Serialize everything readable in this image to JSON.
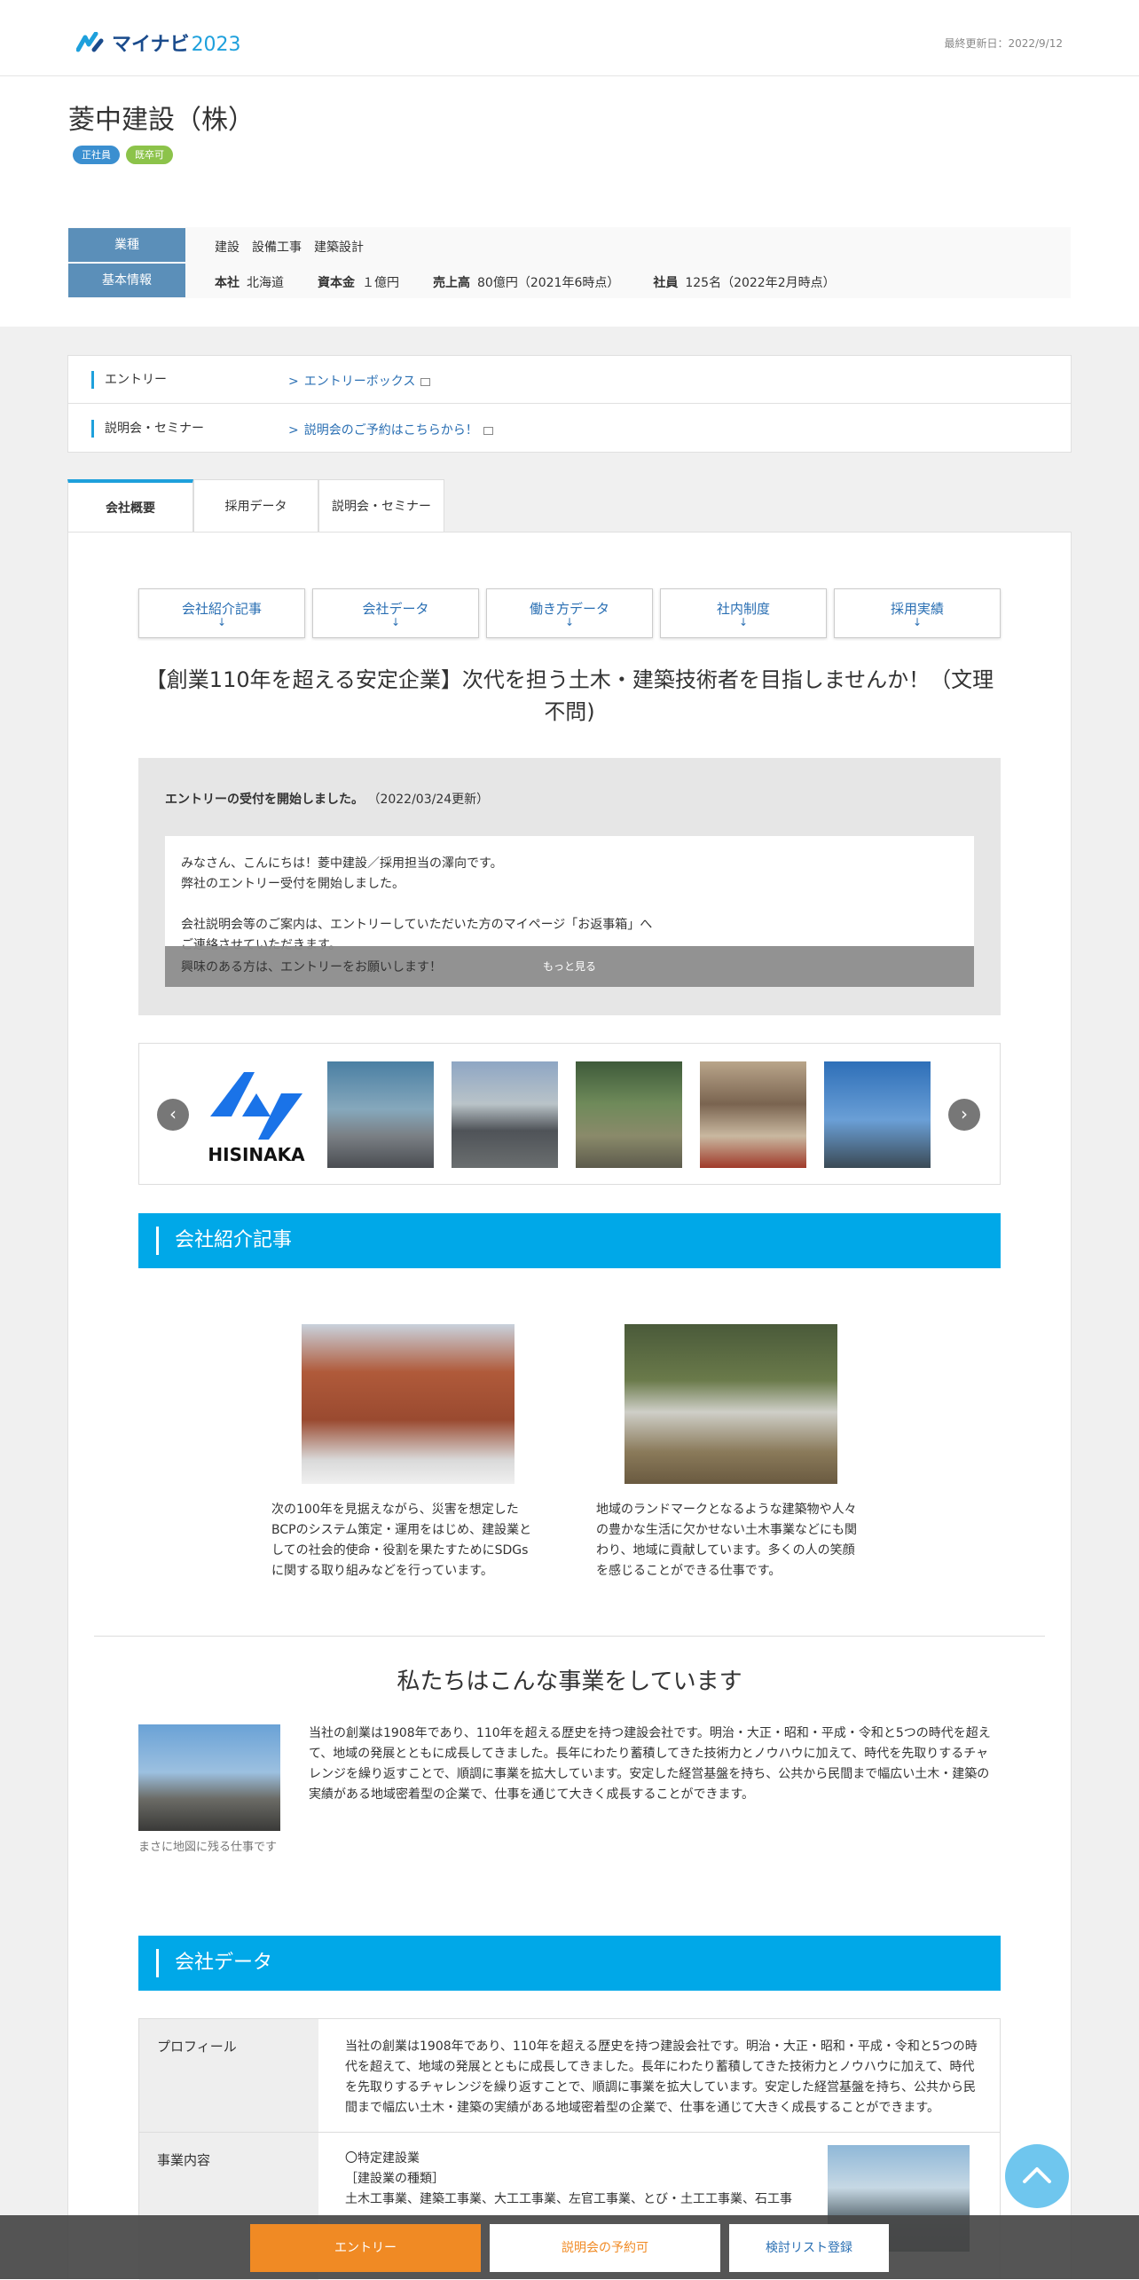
{
  "header": {
    "logo_text": "マイナビ",
    "logo_year": "2023",
    "updated": "最終更新日：2022/9/12"
  },
  "company": {
    "name": "菱中建設（株）",
    "badges": [
      "正社員",
      "既卒可"
    ]
  },
  "info": {
    "industry_label": "業種",
    "industry_value": "建設　設備工事　建築設計",
    "basic_label": "基本情報",
    "hq_label": "本社",
    "hq_value": "北海道",
    "capital_label": "資本金",
    "capital_value": "１億円",
    "sales_label": "売上高",
    "sales_value": "80億円（2021年6時点）",
    "employees_label": "社員",
    "employees_value": "125名（2022年2月時点）"
  },
  "links": [
    {
      "label": "エントリー",
      "link": "エントリーボックス"
    },
    {
      "label": "説明会・セミナー",
      "link": "説明会のご予約はこちらから！"
    }
  ],
  "tabs": [
    "会社概要",
    "採用データ",
    "説明会・セミナー"
  ],
  "anchors": [
    "会社紹介記事",
    "会社データ",
    "働き方データ",
    "社内制度",
    "採用実績"
  ],
  "anchor_arrow": "↓",
  "headline": "【創業110年を超える安定企業】次代を担う土木・建築技術者を目指しませんか！（文理不問)",
  "news": {
    "title": "エントリーの受付を開始しました。",
    "date": "（2022/03/24更新）",
    "lines": [
      "みなさん、こんにちは！菱中建設／採用担当の澤向です。",
      "弊社のエントリー受付を開始しました。",
      "",
      "会社説明会等のご案内は、エントリーしていただいた方のマイページ「お返事箱」へ",
      "ご連絡させていただきます。"
    ],
    "last_line": "興味のある方は、エントリーをお願いします！",
    "more": "もっと見る"
  },
  "carousel": {
    "logo_text": "HISINAKA",
    "prev": "‹",
    "next": "›"
  },
  "sections": {
    "intro": "会社紹介記事",
    "data": "会社データ"
  },
  "articles": [
    {
      "text": "次の100年を見据えながら、災害を想定したBCPのシステム策定・運用をはじめ、建設業としての社会的使命・役割を果たすためにSDGsに関する取り組みなどを行っています。"
    },
    {
      "text": "地域のランドマークとなるような建築物や人々の豊かな生活に欠かせない土木事業などにも関わり、地域に貢献しています。多くの人の笑顔を感じることができる仕事です。"
    }
  ],
  "business": {
    "title": "私たちはこんな事業をしています",
    "caption": "まさに地図に残る仕事です",
    "text": "当社の創業は1908年であり、110年を超える歴史を持つ建設会社です。明治・大正・昭和・平成・令和と5つの時代を超えて、地域の発展とともに成長してきました。長年にわたり蓄積してきた技術力とノウハウに加えて、時代を先取りするチャレンジを繰り返すことで、順調に事業を拡大しています。安定した経営基盤を持ち、公共から民間まで幅広い土木・建築の実績がある地域密着型の企業で、仕事を通じて大きく成長することができます。"
  },
  "company_data": {
    "profile_label": "プロフィール",
    "profile_text": "当社の創業は1908年であり、110年を超える歴史を持つ建設会社です。明治・大正・昭和・平成・令和と5つの時代を超えて、地域の発展とともに成長してきました。長年にわたり蓄積してきた技術力とノウハウに加えて、時代を先取りするチャレンジを繰り返すことで、順調に事業を拡大しています。安定した経営基盤を持ち、公共から民間まで幅広い土木・建築の実績がある地域密着型の企業で、仕事を通じて大きく成長することができます。",
    "business_label": "事業内容",
    "business_lines": [
      "〇特定建設業",
      "［建設業の種類］",
      "土木工事業、建築工事業、大工工事業、左官工事業、とび・土工工事業、石工事"
    ]
  },
  "footer": {
    "entry": "エントリー",
    "seminar": "説明会の予約可",
    "list": "検討リスト登録"
  },
  "colors": {
    "accent": "#00a8e8",
    "header_blue": "#5b8fb9",
    "entry_orange": "#f08a24",
    "badge_blue": "#3b8fd0",
    "badge_green": "#8cc34a"
  }
}
